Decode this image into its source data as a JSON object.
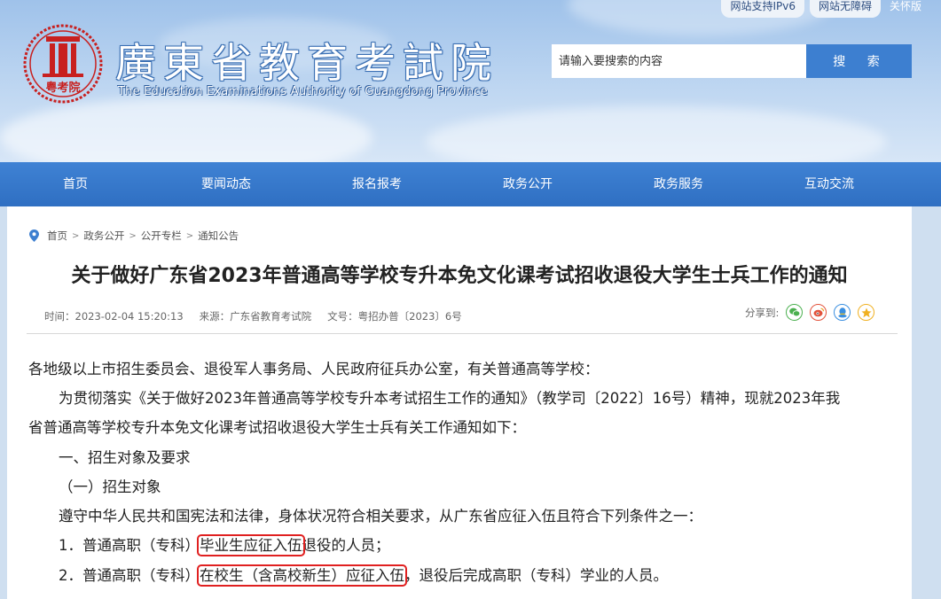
{
  "header": {
    "top_links": [
      "网站支持IPv6",
      "网站无障碍",
      "关怀版"
    ],
    "seal_text": "粤考院",
    "site_name_cn": "廣東省教育考試院",
    "site_name_en": "The Education Examinations Authority of Guangdong Province",
    "search": {
      "placeholder": "请输入要搜索的内容",
      "button_label": "搜 索"
    }
  },
  "nav": {
    "items": [
      "首页",
      "要闻动态",
      "报名报考",
      "政务公开",
      "政务服务",
      "互动交流"
    ]
  },
  "breadcrumb": [
    "首页",
    "政务公开",
    "公开专栏",
    "通知公告"
  ],
  "article": {
    "title": "关于做好广东省2023年普通高等学校专升本免文化课考试招收退役大学生士兵工作的通知",
    "meta": {
      "time": "时间：2023-02-04 15:20:13",
      "source": "来源：广东省教育考试院",
      "doc_no": "文号：粤招办普〔2023〕6号"
    },
    "share_label": "分享到:",
    "share_icons": [
      "wechat-icon",
      "weibo-icon",
      "qq-icon",
      "qzone-icon"
    ],
    "paragraphs": {
      "p1": "各地级以上市招生委员会、退役军人事务局、人民政府征兵办公室，有关普通高等学校：",
      "p2a": "为贯彻落实《关于做好2023年普通高等学校专升本考试招生工作的通知》（教学司〔2022〕16号）精神，现就2023年我",
      "p2b": "省普通高等学校专升本免文化课考试招收退役大学生士兵有关工作通知如下：",
      "h1": "一、招生对象及要求",
      "h2": "（一）招生对象",
      "p3": "遵守中华人民共和国宪法和法律，身体状况符合相关要求，从广东省应征入伍且符合下列条件之一：",
      "item1_pre": "1．普通高职（专科）",
      "item1_hl": "毕业生应征入伍",
      "item1_post": "退役的人员；",
      "item2_pre": "2．普通高职（专科）",
      "item2_hl": "在校生（含高校新生）应征入伍",
      "item2_post": "，退役后完成高职（专科）学业的人员。"
    }
  },
  "colors": {
    "nav_blue": "#3a7bd0",
    "search_button": "#3d7fd0",
    "seal_red": "#c8201f",
    "highlight_red": "#e02020"
  }
}
